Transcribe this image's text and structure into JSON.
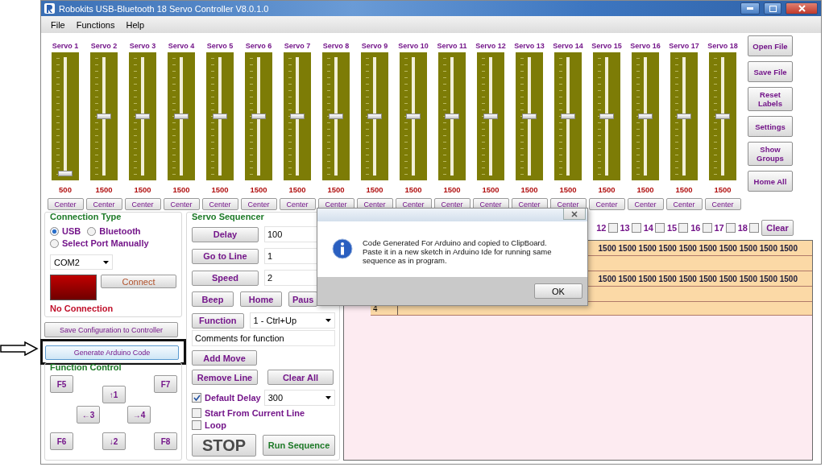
{
  "window": {
    "title": "Robokits USB-Bluetooth 18 Servo Controller V8.0.1.0"
  },
  "menu": [
    "File",
    "Functions",
    "Help"
  ],
  "servos": [
    {
      "label": "Servo 1",
      "level": 0,
      "value": "500",
      "button": "Center"
    },
    {
      "label": "Servo 2",
      "level": 0.5,
      "value": "1500",
      "button": "Center"
    },
    {
      "label": "Servo 3",
      "level": 0.5,
      "value": "1500",
      "button": "Center"
    },
    {
      "label": "Servo 4",
      "level": 0.5,
      "value": "1500",
      "button": "Center"
    },
    {
      "label": "Servo 5",
      "level": 0.5,
      "value": "1500",
      "button": "Center"
    },
    {
      "label": "Servo 6",
      "level": 0.5,
      "value": "1500",
      "button": "Center"
    },
    {
      "label": "Servo 7",
      "level": 0.5,
      "value": "1500",
      "button": "Center"
    },
    {
      "label": "Servo 8",
      "level": 0.5,
      "value": "1500",
      "button": "Center"
    },
    {
      "label": "Servo 9",
      "level": 0.5,
      "value": "1500",
      "button": "Center"
    },
    {
      "label": "Servo 10",
      "level": 0.5,
      "value": "1500",
      "button": "Center"
    },
    {
      "label": "Servo 11",
      "level": 0.5,
      "value": "1500",
      "button": "Center"
    },
    {
      "label": "Servo 12",
      "level": 0.5,
      "value": "1500",
      "button": "Center"
    },
    {
      "label": "Servo 13",
      "level": 0.5,
      "value": "1500",
      "button": "Center"
    },
    {
      "label": "Servo 14",
      "level": 0.5,
      "value": "1500",
      "button": "Center"
    },
    {
      "label": "Servo 15",
      "level": 0.5,
      "value": "1500",
      "button": "Center"
    },
    {
      "label": "Servo 16",
      "level": 0.5,
      "value": "1500",
      "button": "Center"
    },
    {
      "label": "Servo 17",
      "level": 0.5,
      "value": "1500",
      "button": "Center"
    },
    {
      "label": "Servo 18",
      "level": 0.5,
      "value": "1500",
      "button": "Center"
    }
  ],
  "side_buttons": [
    "Open File",
    "Save File",
    "Reset Labels",
    "Settings",
    "Show Groups",
    "Home All"
  ],
  "connection": {
    "title": "Connection Type",
    "options": [
      {
        "label": "USB",
        "selected": true
      },
      {
        "label": "Bluetooth",
        "selected": false
      },
      {
        "label": "Select Port Manually",
        "selected": false
      }
    ],
    "port": "COM2",
    "connected": false,
    "connect_button": "Connect",
    "status": "No Connection"
  },
  "save_config_button": "Save Configuration to Controller",
  "generate_button": {
    "label": "Generate Arduino Code",
    "highlighted": true
  },
  "function_control": {
    "title": "Function Control",
    "keys": [
      "F5",
      "↑1",
      "F7",
      "←3",
      "→4",
      "F6",
      "↓2",
      "F8"
    ]
  },
  "sequencer": {
    "title": "Servo Sequencer",
    "params": [
      {
        "button": "Delay",
        "value": "100"
      },
      {
        "button": "Go to Line",
        "value": "1"
      },
      {
        "button": "Speed",
        "value": "2"
      }
    ],
    "actions": [
      "Beep",
      "Home",
      "Paus"
    ],
    "function_button": "Function",
    "function_select": "1 - Ctrl+Up",
    "comment": "Comments for function",
    "add_move": "Add Move",
    "remove_line": "Remove Line",
    "clear_all": "Clear All",
    "options": [
      {
        "label": "Default Delay",
        "checked": true
      },
      {
        "label": "Start From Current Line",
        "checked": false
      },
      {
        "label": "Loop",
        "checked": false
      }
    ],
    "default_delay": "300",
    "stop": "STOP",
    "run": "Run Sequence"
  },
  "channel_checks": [
    {
      "label": "12",
      "checked": false
    },
    {
      "label": "13",
      "checked": false
    },
    {
      "label": "14",
      "checked": false
    },
    {
      "label": "15",
      "checked": false
    },
    {
      "label": "16",
      "checked": false
    },
    {
      "label": "17",
      "checked": false
    },
    {
      "label": "18",
      "checked": false
    }
  ],
  "clear_button": "Clear",
  "grid": {
    "rows": [
      {
        "index": "",
        "values": "1500 1500 1500 1500 1500 1500 1500 1500 1500 1500"
      },
      {
        "index": "",
        "values": ""
      },
      {
        "index": "",
        "values": "1500 1500 1500 1500 1500 1500 1500 1500 1500 1500"
      },
      {
        "index": "",
        "values": ""
      },
      {
        "index": "4",
        "values": ""
      }
    ]
  },
  "dialog": {
    "lines": [
      "Code Generated For Arduino and copied to ClipBoard.",
      "Paste it in a new sketch in Arduino Ide for running same sequence as in program."
    ],
    "ok": "OK"
  }
}
